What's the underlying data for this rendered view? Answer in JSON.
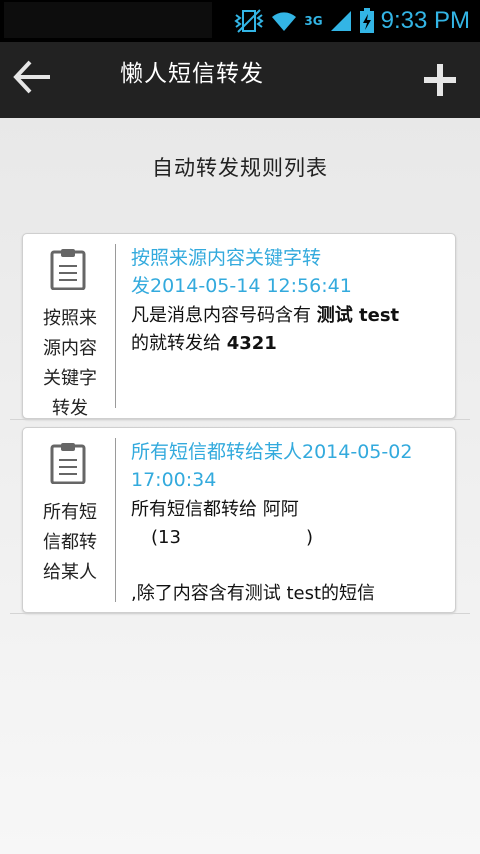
{
  "status_bar": {
    "time": "9:33 PM",
    "network_label": "3G",
    "accent_color": "#33b5e5"
  },
  "action_bar": {
    "title": "懒人短信转发",
    "back_icon": "arrow-left-icon",
    "add_icon": "plus-icon"
  },
  "page": {
    "section_title": "自动转发规则列表"
  },
  "rules": [
    {
      "icon": "clipboard-icon",
      "type_label": [
        "按照来",
        "源内容",
        "关键字",
        "转发"
      ],
      "title_line1": "按照来源内容关键字转",
      "title_line2": "发2014-05-14 12:56:41",
      "desc_line1_prefix": "凡是消息内容号码含有 ",
      "desc_line1_bold": "测试 test",
      "desc_line2_prefix": "的就转发给 ",
      "desc_line2_bold": "4321"
    },
    {
      "icon": "clipboard-icon",
      "type_label": [
        "所有短",
        "信都转",
        "给某人"
      ],
      "title_line1": "所有短信都转给某人2014-05-02",
      "title_line2": "17:00:34",
      "desc_line1": "所有短信都转给 阿阿",
      "desc_line2_open": "(13",
      "desc_line2_close": ")",
      "desc_line3": ",除了内容含有测试 test的短信"
    }
  ]
}
